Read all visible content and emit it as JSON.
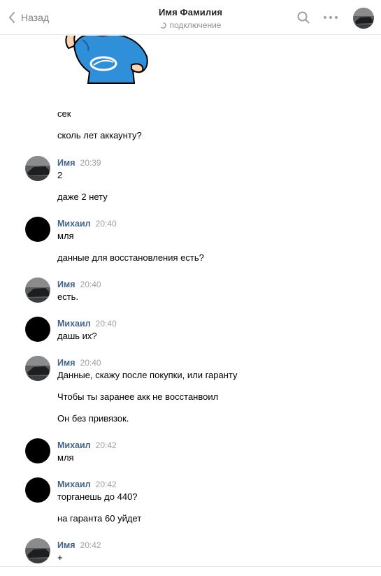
{
  "header": {
    "back_label": "Назад",
    "title": "Имя Фамилия",
    "status": "подключение",
    "icons": {
      "back": "chevron-left-icon",
      "search": "search-icon",
      "more": "more-dots-icon",
      "status": "loading-spinner-icon"
    }
  },
  "colors": {
    "author": "#42648b",
    "time": "#a0a0a0",
    "divider": "#e7e8ec",
    "hoodie": "#2f8fd8"
  },
  "feed": {
    "pre_lines": [
      "сек",
      "сколь лет аккаунту?"
    ],
    "groups": [
      {
        "author": "Имя",
        "time": "20:39",
        "avatar": "photo",
        "lines": [
          "2",
          "даже 2 нету"
        ]
      },
      {
        "author": "Михаил",
        "time": "20:40",
        "avatar": "black",
        "lines": [
          "мля",
          "данные для восстановления есть?"
        ]
      },
      {
        "author": "Имя",
        "time": "20:40",
        "avatar": "photo",
        "lines": [
          "есть."
        ]
      },
      {
        "author": "Михаил",
        "time": "20:40",
        "avatar": "black",
        "lines": [
          "дашь их?"
        ]
      },
      {
        "author": "Имя",
        "time": "20:40",
        "avatar": "photo",
        "lines": [
          "Данные, скажу после покупки, или гаранту",
          "Чтобы ты заранее акк не восстанвоил",
          "Он без привязок."
        ]
      },
      {
        "author": "Михаил",
        "time": "20:42",
        "avatar": "black",
        "lines": [
          "мля"
        ]
      },
      {
        "author": "Михаил",
        "time": "20:42",
        "avatar": "black",
        "lines": [
          "торганешь до 440?",
          "на гаранта 60 уйдет"
        ]
      },
      {
        "author": "Имя",
        "time": "20:42",
        "avatar": "photo",
        "lines": [
          "+"
        ]
      }
    ]
  }
}
